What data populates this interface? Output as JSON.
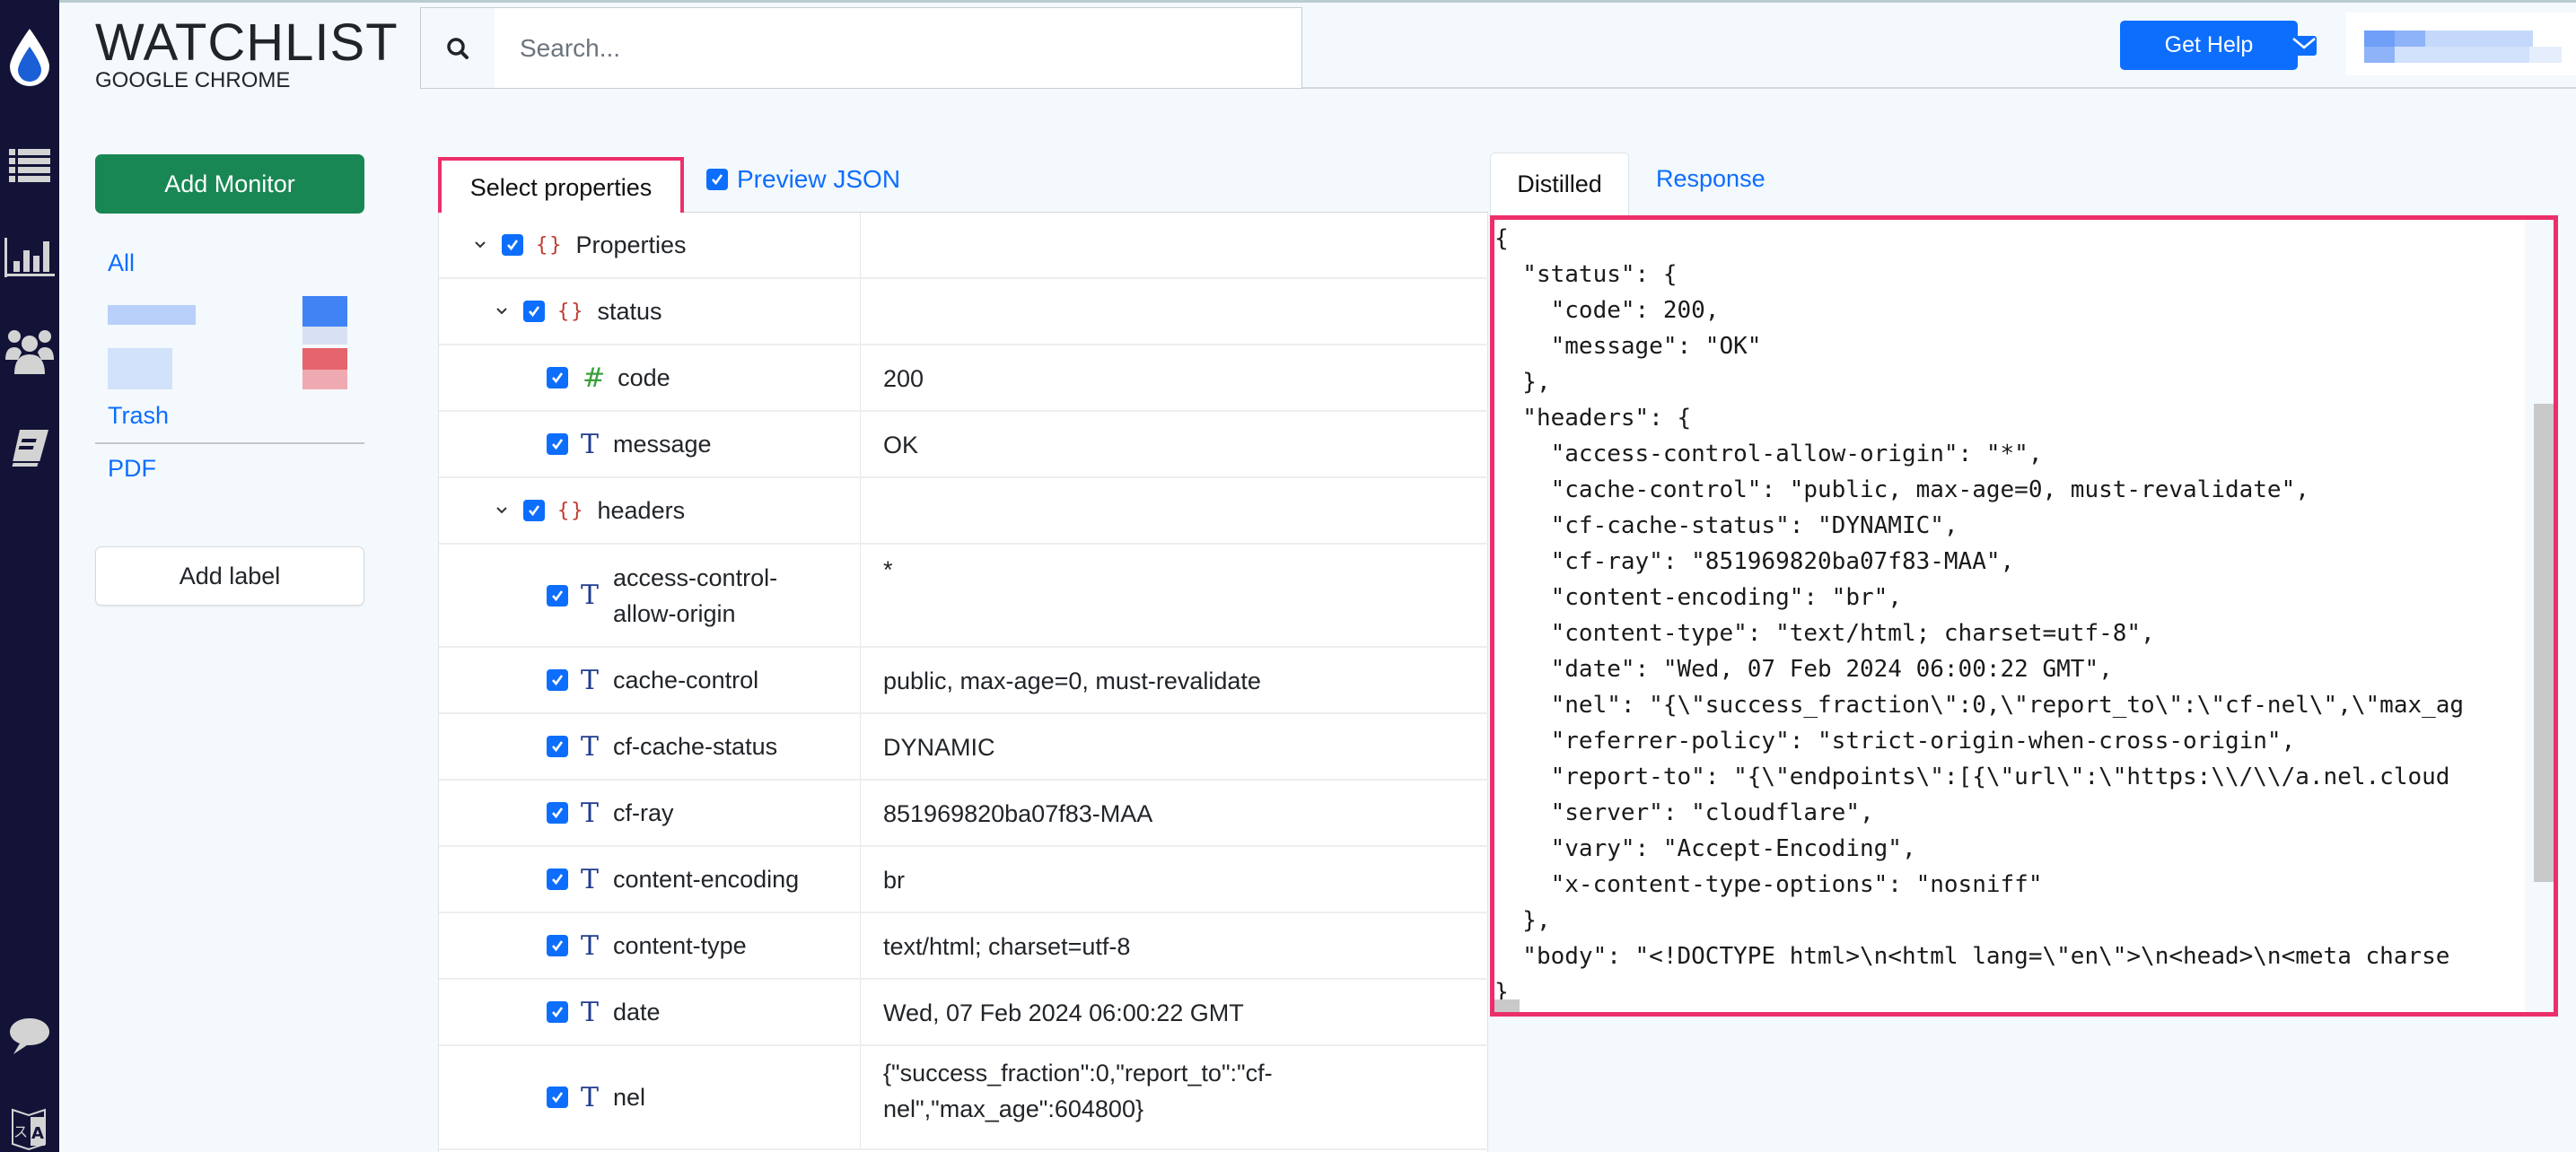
{
  "app": {
    "title": "WATCHLIST",
    "subtitle": "GOOGLE CHROME"
  },
  "nav": {
    "icons": [
      "logo-drop-icon",
      "list-icon",
      "chart-icon",
      "users-icon",
      "book-icon",
      "chat-icon",
      "translate-icon"
    ]
  },
  "header": {
    "search_placeholder": "Search...",
    "search_value": "",
    "get_help_label": "Get Help",
    "user_name": "[redacted]"
  },
  "sidebar": {
    "add_monitor_label": "Add Monitor",
    "links": [
      {
        "label": "All"
      },
      {
        "label": "Trash"
      },
      {
        "label": "PDF"
      }
    ],
    "add_label_label": "Add label"
  },
  "properties_panel": {
    "tab_label": "Select properties",
    "preview_json_label": "Preview JSON",
    "preview_json_checked": true,
    "rows": [
      {
        "key": "Properties",
        "type": "object",
        "depth": 0,
        "expanded": true,
        "checked": true,
        "value": ""
      },
      {
        "key": "status",
        "type": "object",
        "depth": 1,
        "expanded": true,
        "checked": true,
        "value": ""
      },
      {
        "key": "code",
        "type": "number",
        "depth": 2,
        "checked": true,
        "value": "200"
      },
      {
        "key": "message",
        "type": "string",
        "depth": 2,
        "checked": true,
        "value": "OK"
      },
      {
        "key": "headers",
        "type": "object",
        "depth": 1,
        "expanded": true,
        "checked": true,
        "value": ""
      },
      {
        "key": "access-control-allow-origin",
        "key_lines": [
          "access-control-",
          "allow-origin"
        ],
        "type": "string",
        "depth": 2,
        "checked": true,
        "value": "*"
      },
      {
        "key": "cache-control",
        "type": "string",
        "depth": 2,
        "checked": true,
        "value": "public, max-age=0, must-revalidate"
      },
      {
        "key": "cf-cache-status",
        "type": "string",
        "depth": 2,
        "checked": true,
        "value": "DYNAMIC"
      },
      {
        "key": "cf-ray",
        "type": "string",
        "depth": 2,
        "checked": true,
        "value": "851969820ba07f83-MAA"
      },
      {
        "key": "content-encoding",
        "type": "string",
        "depth": 2,
        "checked": true,
        "value": "br"
      },
      {
        "key": "content-type",
        "type": "string",
        "depth": 2,
        "checked": true,
        "value": "text/html; charset=utf-8"
      },
      {
        "key": "date",
        "type": "string",
        "depth": 2,
        "checked": true,
        "value": "Wed, 07 Feb 2024 06:00:22 GMT"
      },
      {
        "key": "nel",
        "type": "string",
        "depth": 2,
        "checked": true,
        "value_lines": [
          "{\"success_fraction\":0,\"report_to\":\"cf-",
          "nel\",\"max_age\":604800}"
        ]
      }
    ]
  },
  "preview_panel": {
    "tabs": [
      {
        "label": "Distilled",
        "active": true
      },
      {
        "label": "Response",
        "active": false
      }
    ],
    "json_lines": [
      "{",
      "  \"status\": {",
      "    \"code\": 200,",
      "    \"message\": \"OK\"",
      "  },",
      "  \"headers\": {",
      "    \"access-control-allow-origin\": \"*\",",
      "    \"cache-control\": \"public, max-age=0, must-revalidate\",",
      "    \"cf-cache-status\": \"DYNAMIC\",",
      "    \"cf-ray\": \"851969820ba07f83-MAA\",",
      "    \"content-encoding\": \"br\",",
      "    \"content-type\": \"text/html; charset=utf-8\",",
      "    \"date\": \"Wed, 07 Feb 2024 06:00:22 GMT\",",
      "    \"nel\": \"{\\\"success_fraction\\\":0,\\\"report_to\\\":\\\"cf-nel\\\",\\\"max_ag",
      "    \"referrer-policy\": \"strict-origin-when-cross-origin\",",
      "    \"report-to\": \"{\\\"endpoints\\\":[{\\\"url\\\":\\\"https:\\\\/\\\\/a.nel.cloud",
      "    \"server\": \"cloudflare\",",
      "    \"vary\": \"Accept-Encoding\",",
      "    \"x-content-type-options\": \"nosniff\"",
      "  },",
      "  \"body\": \"<!DOCTYPE html>\\n<html lang=\\\"en\\\">\\n<head>\\n<meta charse",
      "}"
    ]
  },
  "colors": {
    "nav_bg": "#131338",
    "accent_blue": "#0d6efd",
    "success_green": "#198754",
    "highlight_pink": "#ec2f6a",
    "object_type": "#c0392b",
    "number_type": "#3aa03a",
    "string_type": "#1f3b8f"
  }
}
